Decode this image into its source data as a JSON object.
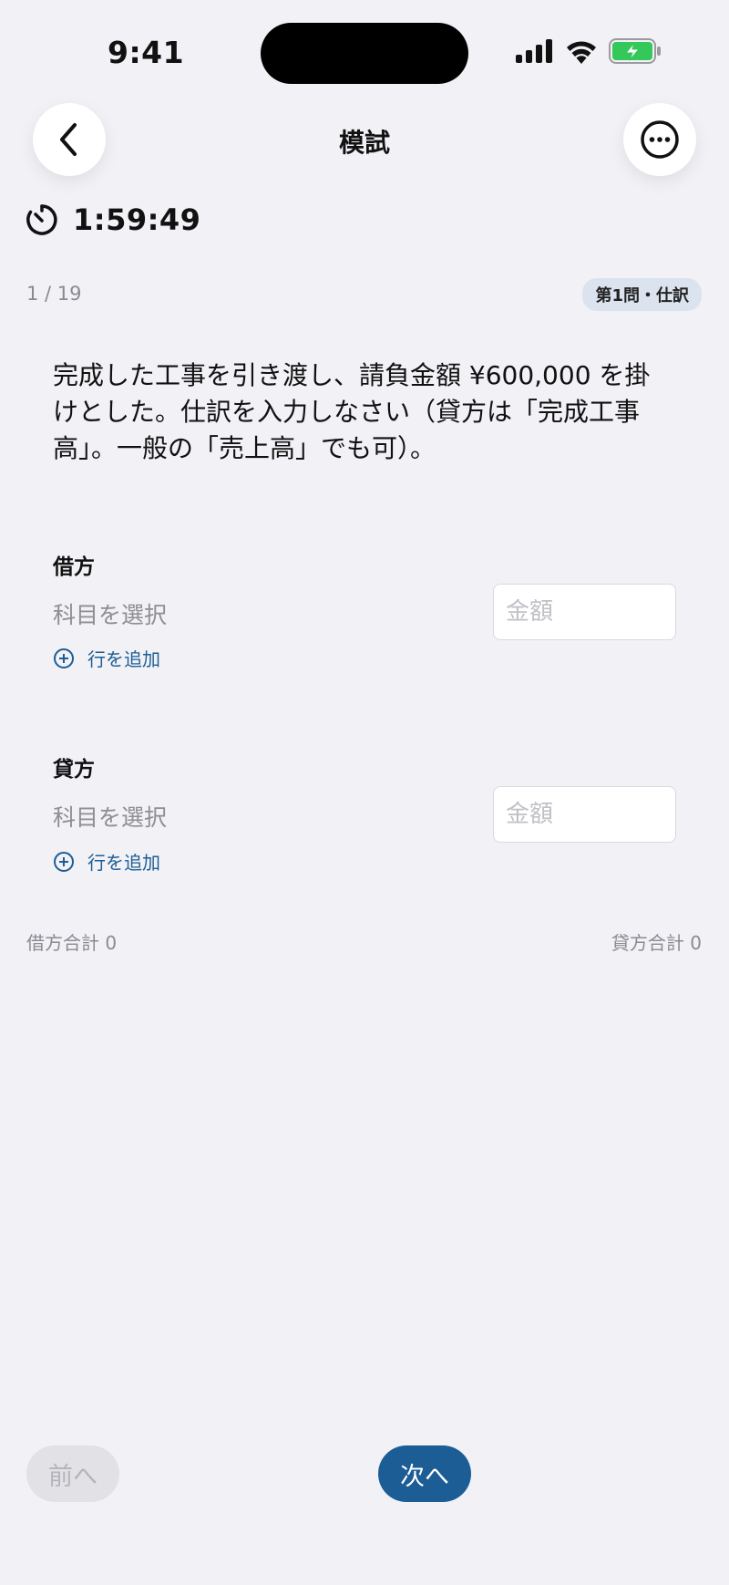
{
  "status_bar": {
    "time": "9:41",
    "icons": [
      "signal-icon",
      "wifi-icon",
      "battery-charging-icon"
    ],
    "battery_color": "#34c759"
  },
  "nav": {
    "title": "模試",
    "back_icon": "chevron-left-icon",
    "more_icon": "more-circle-icon"
  },
  "timer": {
    "icon": "timer-icon",
    "value": "1:59:49"
  },
  "progress": {
    "text": "1 / 19",
    "badge": "第1問・仕訳"
  },
  "question": {
    "text": "完成した工事を引き渡し、請負金額 ¥600,000 を掛けとした。仕訳を入力しなさい（貸方は「完成工事高」。一般の「売上高」でも可）。"
  },
  "debit": {
    "label": "借方",
    "account_placeholder": "科目を選択",
    "amount_placeholder": "金額",
    "amount_value": "",
    "add_row_label": "行を追加"
  },
  "credit": {
    "label": "貸方",
    "account_placeholder": "科目を選択",
    "amount_placeholder": "金額",
    "amount_value": "",
    "add_row_label": "行を追加"
  },
  "totals": {
    "debit": "借方合計 0",
    "credit": "貸方合計 0"
  },
  "footer": {
    "prev_label": "前へ",
    "next_label": "次へ"
  },
  "colors": {
    "accent": "#1c5d95",
    "background": "#f1f1f6",
    "badge_bg": "#dbe3ee"
  }
}
